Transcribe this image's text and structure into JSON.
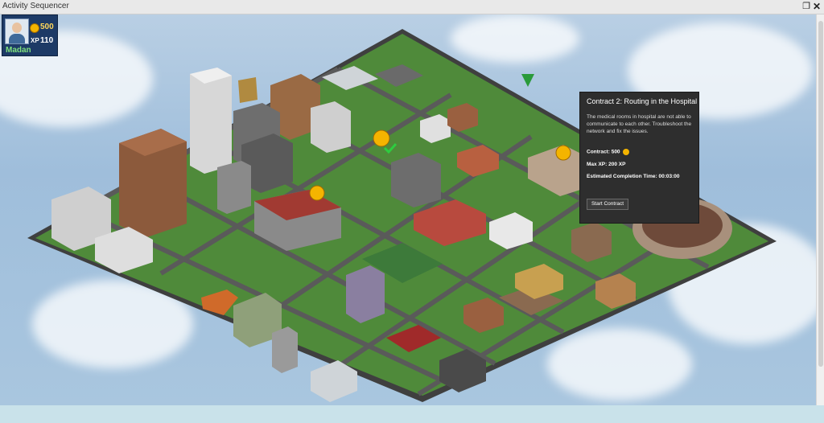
{
  "window": {
    "title": "Activity Sequencer"
  },
  "player": {
    "name": "Madan",
    "coins": "500",
    "xp_label": "XP",
    "xp": "110"
  },
  "contract_panel": {
    "title": "Contract 2: Routing in the Hospital",
    "description": "The medical rooms in hospital are not able to communicate to each other. Troubleshoot the network and fix the issues.",
    "contract_label": "Contract:",
    "contract_value": "500",
    "max_xp_label": "Max XP:",
    "max_xp_value": "200 XP",
    "time_label": "Estimated Completion Time:",
    "time_value": "00:03:00",
    "start_button": "Start Contract"
  },
  "colors": {
    "grass": "#4f8a3a",
    "road": "#5a5a5a",
    "panel": "#2e2e2e",
    "player_card": "#1d3a66",
    "coin": "#f4b400"
  },
  "icons": [
    "restore-icon",
    "close-icon",
    "coin-icon",
    "avatar-icon",
    "contract-marker-icon",
    "tent-marker-icon",
    "completed-check-icon"
  ]
}
